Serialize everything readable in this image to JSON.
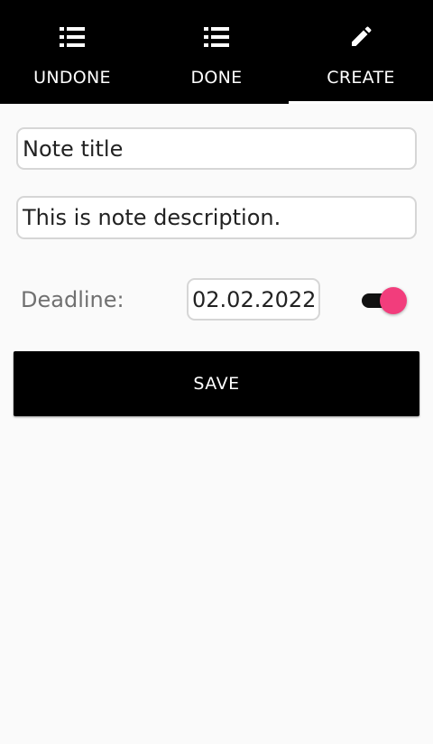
{
  "tabs": [
    {
      "label": "UNDONE",
      "icon": "list-icon",
      "selected": false
    },
    {
      "label": "DONE",
      "icon": "list-icon",
      "selected": false
    },
    {
      "label": "CREATE",
      "icon": "pencil-icon",
      "selected": true
    }
  ],
  "form": {
    "title_value": "Note title",
    "description_value": "This is note description.",
    "deadline_label": "Deadline:",
    "deadline_value": "02.02.2022",
    "deadline_enabled": true
  },
  "save_label": "SAVE",
  "colors": {
    "tabbar_background": "#000000",
    "background": "#fafafa",
    "toggle_accent": "#f23d7c",
    "button_background": "#000000"
  }
}
